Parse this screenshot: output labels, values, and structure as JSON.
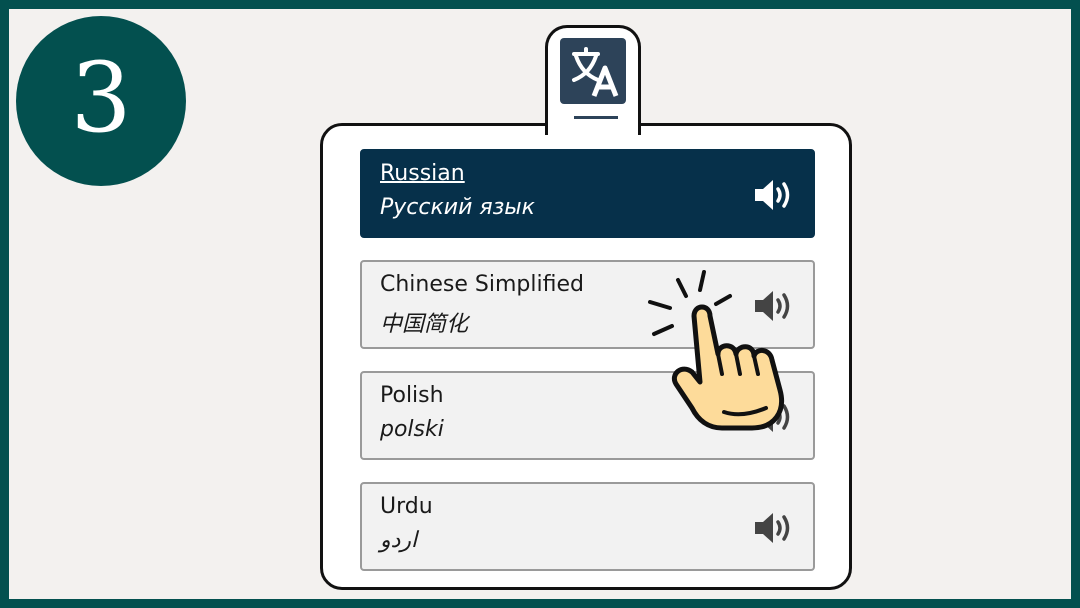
{
  "step": {
    "number": "3"
  },
  "tab": {
    "icon": "translate-icon"
  },
  "languages": [
    {
      "name": "Russian",
      "native": "Русский язык",
      "selected": true
    },
    {
      "name": "Chinese Simplified",
      "native": "中国简化",
      "selected": false
    },
    {
      "name": "Polish",
      "native": "polski",
      "selected": false
    },
    {
      "name": "Urdu",
      "native": "اردو",
      "selected": false
    }
  ],
  "colors": {
    "frame": "#03504f",
    "background": "#f3f1ef",
    "selected_row": "#06304a",
    "icon_tile": "#2d4359",
    "hand_fill": "#fddb9a"
  },
  "overlay": {
    "icon": "pointing-hand-icon"
  }
}
